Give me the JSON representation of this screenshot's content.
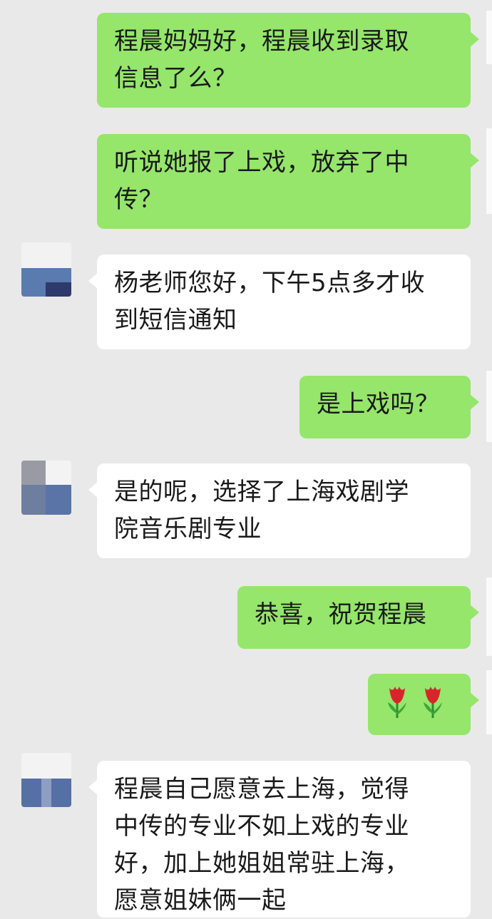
{
  "messages": [
    {
      "side": "out",
      "lines": [
        "程晨妈妈好，程晨收到录取",
        "信息了么？"
      ]
    },
    {
      "side": "out",
      "lines": [
        "听说她报了上戏，放弃了中",
        "传？"
      ]
    },
    {
      "side": "in",
      "lines": [
        "杨老师您好，下午5点多才收",
        "到短信通知"
      ]
    },
    {
      "side": "out",
      "lines": [
        "是上戏吗？"
      ]
    },
    {
      "side": "in",
      "lines": [
        "是的呢，选择了上海戏剧学",
        "院音乐剧专业"
      ]
    },
    {
      "side": "out",
      "lines": [
        "恭喜，祝贺程晨"
      ]
    },
    {
      "side": "out",
      "emoji": [
        "tulip-icon",
        "tulip-icon"
      ]
    },
    {
      "side": "in",
      "lines": [
        "程晨自己愿意去上海，觉得",
        "中传的专业不如上戏的专业",
        "好，加上她姐姐常驻上海，",
        "愿意姐妹俩一起"
      ]
    }
  ],
  "colors": {
    "outgoing": "#95e66b",
    "incoming": "#ffffff",
    "background": "#e9e9e9"
  }
}
